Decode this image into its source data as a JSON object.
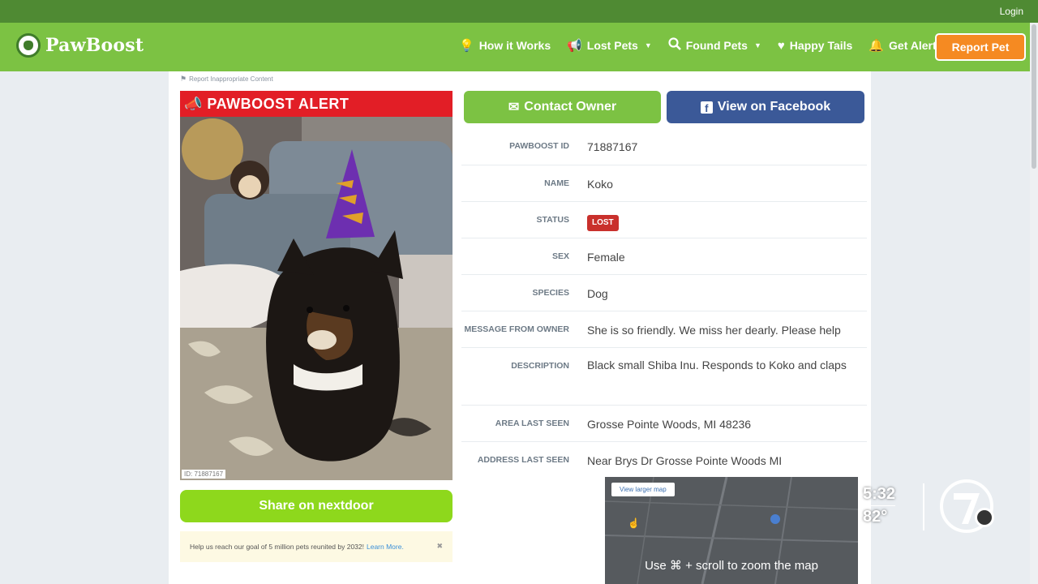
{
  "header": {
    "login": "Login",
    "logo_text": "PawBoost",
    "nav": [
      {
        "icon": "lightbulb-icon",
        "label": "How it Works",
        "caret": false
      },
      {
        "icon": "megaphone-icon",
        "label": "Lost Pets",
        "caret": true
      },
      {
        "icon": "search-icon",
        "label": "Found Pets",
        "caret": true
      },
      {
        "icon": "heart-icon",
        "label": "Happy Tails",
        "caret": false
      },
      {
        "icon": "bell-icon",
        "label": "Get Alerts",
        "caret": false
      }
    ],
    "report_button": "Report Pet"
  },
  "left": {
    "report_link": "Report Inappropriate Content",
    "alert_title": "PAWBOOST ALERT",
    "photo_id": "ID: 71887167",
    "share_button": "Share on nextdoor",
    "goal_text": "Help us reach our goal of 5 million pets reunited by 2032!",
    "goal_link": "Learn More.",
    "goal_close": "✖"
  },
  "actions": {
    "contact": "Contact Owner",
    "facebook": "View on Facebook"
  },
  "details": [
    {
      "label": "PAWBOOST ID",
      "value": "71887167"
    },
    {
      "label": "NAME",
      "value": "Koko"
    },
    {
      "label": "STATUS",
      "value": "LOST",
      "badge": true
    },
    {
      "label": "SEX",
      "value": "Female"
    },
    {
      "label": "SPECIES",
      "value": "Dog"
    },
    {
      "label": "MESSAGE FROM OWNER",
      "value": "She is so friendly. We miss her dearly. Please help"
    },
    {
      "label": "DESCRIPTION",
      "value": "Black small Shiba Inu. Responds to Koko and claps"
    },
    {
      "label": "AREA LAST SEEN",
      "value": "Grosse Pointe Woods, MI 48236"
    },
    {
      "label": "ADDRESS LAST SEEN",
      "value": "Near Brys Dr Grosse Pointe Woods MI"
    }
  ],
  "map": {
    "larger_map": "View larger map",
    "overlay": "Use ⌘ + scroll to zoom the map"
  },
  "broadcast": {
    "time": "5:32",
    "temp": "82°"
  },
  "colors": {
    "topbar": "#4f8a33",
    "nav": "#7cc243",
    "report": "#f58a22",
    "alert": "#e21e26",
    "facebook": "#3b5998",
    "nextdoor": "#8ed81c",
    "lost": "#c9302c"
  }
}
